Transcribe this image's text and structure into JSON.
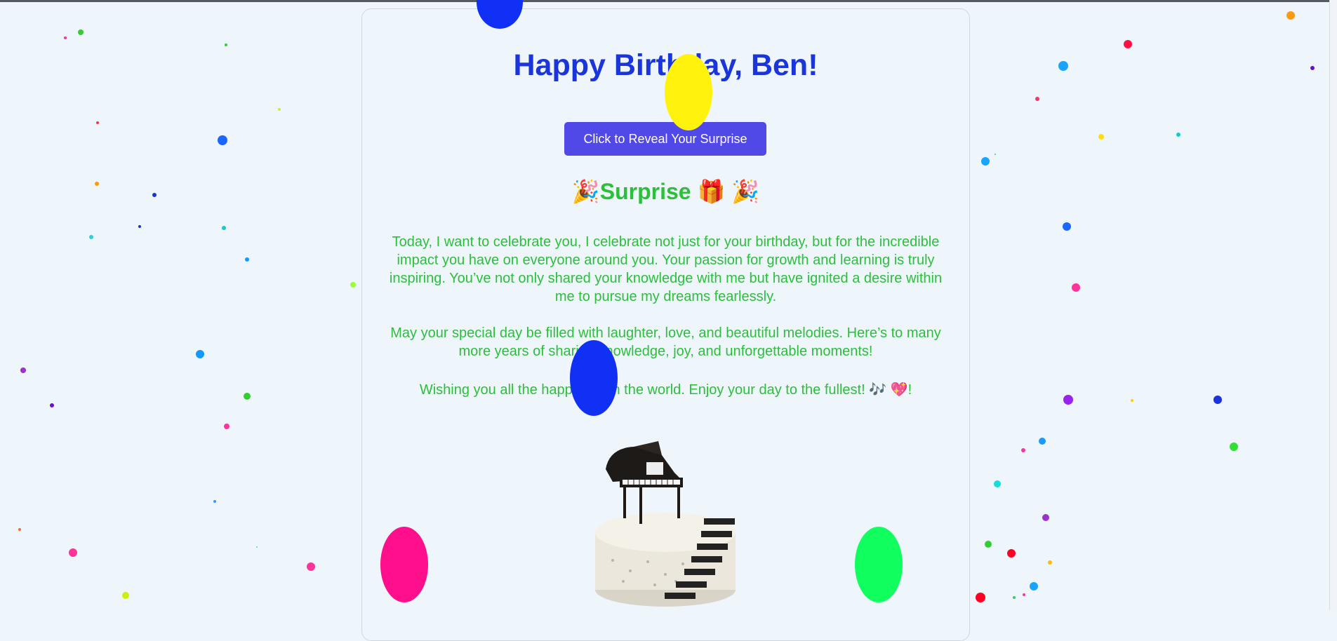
{
  "greeting": {
    "title": "Happy Birthday, Ben!",
    "reveal_button": "Click to Reveal Your Surprise"
  },
  "surprise": {
    "heading": "Surprise",
    "heading_emoji_left": "🎉",
    "heading_emoji_gift": "🎁",
    "heading_emoji_right": "🎉",
    "paragraph_1": "Today, I want to celebrate you, I celebrate not just for your birthday, but for the incredible impact you have on everyone around you. Your passion for growth and learning is truly inspiring. You’ve not only shared your knowledge with me but have ignited a desire within me to pursue my dreams fearlessly.",
    "paragraph_2": "May your special day be filled with laughter, love, and beautiful melodies. Here’s to many more years of sharing knowledge, joy, and unforgettable moments!",
    "paragraph_3": "Wishing you all the happiness in the world. Enjoy your day to the fullest! 🎶 💖!"
  },
  "image": {
    "cake_icon": "piano-cake-image"
  },
  "colors": {
    "title": "#1a35d9",
    "button": "#5148e8",
    "text": "#2bbf3a",
    "background": "#eef6fc"
  }
}
